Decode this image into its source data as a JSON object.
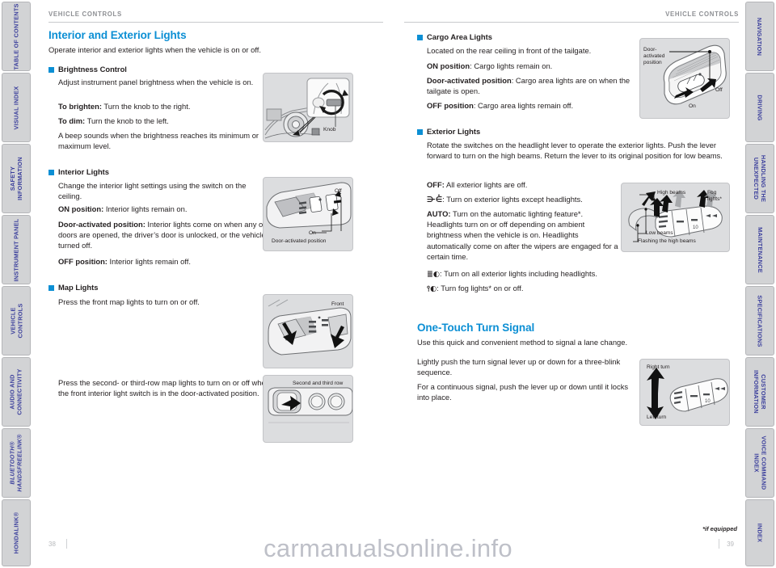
{
  "document": {
    "watermark": "carmanualsonline.info"
  },
  "left_tabs": [
    {
      "label": "TABLE OF CONTENTS",
      "italic": false
    },
    {
      "label": "VISUAL INDEX",
      "italic": false
    },
    {
      "label": "SAFETY\nINFORMATION",
      "italic": false
    },
    {
      "label": "INSTRUMENT PANEL",
      "italic": false
    },
    {
      "label": "VEHICLE\nCONTROLS",
      "italic": false
    },
    {
      "label": "AUDIO AND\nCONNECTIVITY",
      "italic": false
    },
    {
      "label": "BLUETOOTH®\nHANDSFREELINK®",
      "italic": true
    },
    {
      "label": "HONDALINK®",
      "italic": false
    }
  ],
  "right_tabs": [
    {
      "label": "NAVIGATION"
    },
    {
      "label": "DRIVING"
    },
    {
      "label": "HANDLING THE\nUNEXPECTED"
    },
    {
      "label": "MAINTENANCE"
    },
    {
      "label": "SPECIFICATIONS"
    },
    {
      "label": "CUSTOMER\nINFORMATION"
    },
    {
      "label": "VOICE COMMAND\nINDEX"
    },
    {
      "label": "INDEX"
    }
  ],
  "left_page": {
    "running_head": "VEHICLE CONTROLS",
    "page_number": "38",
    "title": "Interior and Exterior Lights",
    "lead": "Operate interior and exterior lights when the vehicle is on or off.",
    "brightness": {
      "heading": "Brightness Control",
      "p1": "Adjust instrument panel brightness when the vehicle is on.",
      "p2_label": "To brighten:",
      "p2_text": " Turn the knob to the right.",
      "p3_label": "To dim:",
      "p3_text": " Turn the knob to the left.",
      "p4": "A beep sounds when the brightness reaches its minimum or maximum level.",
      "figure_caption": "Knob"
    },
    "interior": {
      "heading": "Interior Lights",
      "p1": "Change the interior light settings using the switch on the ceiling.",
      "p2_label": "ON position:",
      "p2_text": " Interior lights remain on.",
      "p3_label": "Door-activated position:",
      "p3_text": " Interior lights come on when any of the doors are opened, the driver’s door is unlocked, or the vehicle is turned off.",
      "p4_label": "OFF position:",
      "p4_text": " Interior lights remain off.",
      "figure_caption_off": "Off",
      "figure_caption_on": "On",
      "figure_caption_door": "Door-activated position"
    },
    "map": {
      "heading": "Map Lights",
      "p1": "Press the front map lights to turn on or off.",
      "p2": "Press the second- or third-row map lights to turn on or off when the front interior light switch is in the door-activated position.",
      "figure1_caption": "Front",
      "figure2_caption": "Second and third row"
    }
  },
  "right_page": {
    "running_head": "VEHICLE CONTROLS",
    "page_number": "39",
    "footnote": "*if equipped",
    "cargo": {
      "heading": "Cargo Area Lights",
      "p1": "Located on the rear ceiling in front of the tailgate.",
      "p2_label": "ON position",
      "p2_text": ": Cargo lights remain on.",
      "p3_label": "Door-activated position",
      "p3_text": ": Cargo area lights are on when the tailgate is open.",
      "p4_label": "OFF position",
      "p4_text": ": Cargo area lights remain off.",
      "figure_caption_door": "Door-\nactivated\nposition",
      "figure_caption_off": "Off",
      "figure_caption_on": "On"
    },
    "exterior": {
      "heading": "Exterior Lights",
      "p1": "Rotate the switches on the headlight lever to operate the exterior lights. Push the lever forward to turn on the high beams. Return the lever to its original position for low beams.",
      "p2_label": "OFF:",
      "p2_text": " All exterior lights are off.",
      "p3_symbol": "⋺⋵",
      "p3_text": ": Turn on exterior lights except headlights.",
      "p4_label": "AUTO:",
      "p4_text": " Turn on the automatic lighting feature*. Headlights turn on or off depending on ambient brightness when the vehicle is on. Headlights automatically come on after the wipers are engaged for a certain time.",
      "p5_symbol": "≣◐",
      "p5_text": ": Turn on all exterior lights including headlights.",
      "p6_symbol": "⫯◐",
      "p6_text": ": Turn fog lights* on or off.",
      "figure_caption_high": "High beams",
      "figure_caption_fog": "Fog\nlights*",
      "figure_caption_low": "Low beams",
      "figure_caption_flash": "Flashing the high beams"
    },
    "turn_signal": {
      "title": "One-Touch Turn Signal",
      "lead": "Use this quick and convenient method to signal a lane change.",
      "p1": "Lightly push the turn signal lever up or down for a three-blink sequence.",
      "p2": "For a continuous signal, push the lever up or down until it locks into place.",
      "figure_caption_right": "Right turn",
      "figure_caption_left": "Left turn"
    }
  },
  "colors": {
    "accent": "#0c8fd4",
    "tab_text": "#3b3f9c",
    "tab_bg": "#d2d3d5",
    "fig_bg": "#dcdddf",
    "body_text": "#231f20"
  }
}
